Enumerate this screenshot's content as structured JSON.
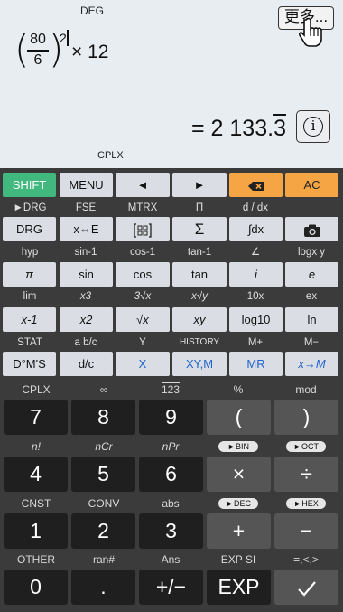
{
  "display": {
    "angle_mode": "DEG",
    "more_button": "更多...",
    "expression": {
      "open_paren": "(",
      "numerator": "80",
      "denominator": "6",
      "close_paren": ")",
      "exponent": "2",
      "times": "× 12"
    },
    "result_prefix": "= 2 133.",
    "result_repeat": "3",
    "info_icon_glyph": "i",
    "complex_mode": "CPLX"
  },
  "keys": {
    "r1": [
      "SHIFT",
      "MENU",
      "◄",
      "►",
      "",
      "AC"
    ],
    "r2_labels": [
      "►DRG",
      "FSE",
      "MTRX",
      "Π",
      "d / dx",
      ""
    ],
    "r2": [
      "DRG",
      "x⇔E",
      "",
      "Σ",
      "∫dx",
      ""
    ],
    "r3_labels": [
      "hyp",
      "sin-1",
      "cos-1",
      "tan-1",
      "∠",
      "logx y"
    ],
    "r3": [
      "π",
      "sin",
      "cos",
      "tan",
      "i",
      "e"
    ],
    "r4_labels": [
      "lim",
      "x3",
      "3√x",
      "x√y",
      "10x",
      "ex"
    ],
    "r4": [
      "x-1",
      "x2",
      "√x",
      "xy",
      "log10",
      "ln"
    ],
    "r5_labels": [
      "STAT",
      "a b/c",
      "Y",
      "HISTORY",
      "M+",
      "M−"
    ],
    "r5": [
      "D°M'S",
      "d/c",
      "X",
      "XY,M",
      "MR",
      "x→M"
    ],
    "r6_labels": [
      "CPLX",
      "∞",
      "123",
      "%",
      "mod"
    ],
    "r6": [
      "7",
      "8",
      "9",
      "(",
      ")"
    ],
    "r7_labels": [
      "n!",
      "nCr",
      "nPr",
      "►BIN",
      "►OCT"
    ],
    "r7": [
      "4",
      "5",
      "6",
      "×",
      "÷"
    ],
    "r8_labels": [
      "CNST",
      "CONV",
      "abs",
      "►DEC",
      "►HEX"
    ],
    "r8": [
      "1",
      "2",
      "3",
      "+",
      "−"
    ],
    "r9_labels": [
      "OTHER",
      "ran#",
      "Ans",
      "EXP SI",
      "=,<,>"
    ],
    "r9": [
      "0",
      ".",
      "+/−",
      "EXP",
      "✓"
    ]
  },
  "colors": {
    "shift": "#41b87e",
    "orange": "#f6a544",
    "blue_text": "#1f64cf",
    "keypad_bg": "#3b3b3b",
    "display_bg": "#e8edf2"
  }
}
